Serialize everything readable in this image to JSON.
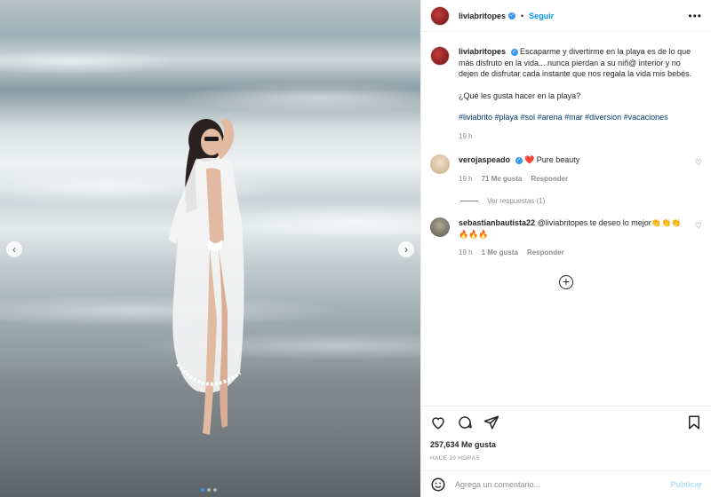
{
  "post": {
    "username": "liviabritopes",
    "follow_label": "Seguir",
    "separator": "•",
    "more_label": "•••"
  },
  "caption": {
    "username": "liviabritopes",
    "text": "Escaparme y divertirme en la playa es de lo que más disfruto en la vida... nunca pierdan a su niñ@ interior y no dejen de disfrutar cada instante que nos regala la vida mis bebés.",
    "question": "¿Qué les gusta hacer en la playa?",
    "hashtags": "#liviabrito #playa #sol #arena #mar #diversion #vacaciones",
    "time": "19 h"
  },
  "comments": [
    {
      "username": "verojaspeado",
      "text": "❤️ Pure beauty",
      "time": "19 h",
      "likes": "71 Me gusta",
      "reply_label": "Responder",
      "view_replies": "Ver respuestas (1)"
    },
    {
      "username": "sebastianbautista22",
      "text": "@liviabritopes te deseo lo mejor👏👏👏🔥🔥🔥",
      "time": "19 h",
      "likes": "1 Me gusta",
      "reply_label": "Responder"
    }
  ],
  "footer": {
    "likes": "257,634 Me gusta",
    "timestamp": "HACE 19 HORAS",
    "comment_placeholder": "Agrega un comentario...",
    "post_label": "Publicar"
  },
  "icons": {
    "like": "heart-icon",
    "comment": "comment-icon",
    "share": "share-icon",
    "save": "bookmark-icon",
    "emoji": "emoji-icon",
    "load_more": "plus-circle-icon"
  },
  "colors": {
    "accent": "#0095f6",
    "verified": "#3897f0",
    "hashtag": "#00376b",
    "muted": "#8e8e8e"
  }
}
